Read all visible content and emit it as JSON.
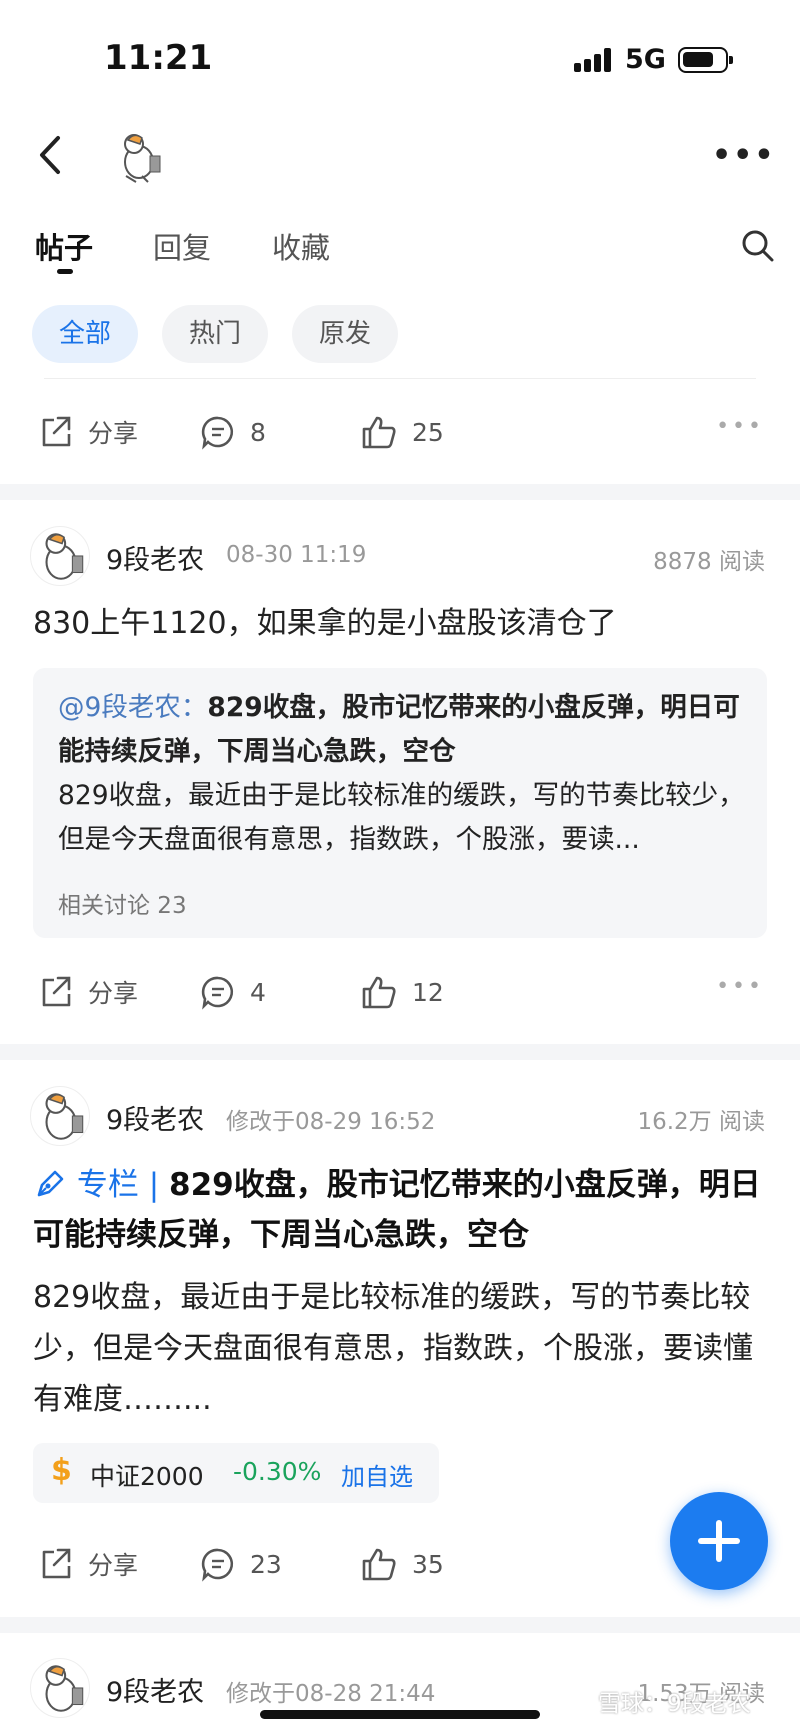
{
  "status": {
    "time": "11:21",
    "network": "5G"
  },
  "tabs": [
    {
      "label": "帖子"
    },
    {
      "label": "回复"
    },
    {
      "label": "收藏"
    }
  ],
  "chips": [
    {
      "label": "全部"
    },
    {
      "label": "热门"
    },
    {
      "label": "原发"
    }
  ],
  "action_labels": {
    "share": "分享"
  },
  "post0": {
    "comments": "8",
    "likes": "25"
  },
  "post1": {
    "author": "9段老农",
    "time": "08-30 11:19",
    "reads": "8878 阅读",
    "text": "830上午1120，如果拿的是小盘股该清仓了",
    "quote": {
      "mention": "@9段老农：",
      "title": "829收盘，股市记忆带来的小盘反弹，明日可能持续反弹，下周当心急跌，空仓",
      "body": "829收盘，最近由于是比较标准的缓跌，写的节奏比较少，但是今天盘面很有意思，指数跌，个股涨，要读...",
      "meta": "相关讨论 23"
    },
    "comments": "4",
    "likes": "12"
  },
  "post2": {
    "author": "9段老农",
    "time": "修改于08-29 16:52",
    "reads": "16.2万 阅读",
    "column_tag": "专栏 |",
    "title": "829收盘，股市记忆带来的小盘反弹，明日可能持续反弹，下周当心急跌，空仓",
    "text": "829收盘，最近由于是比较标准的缓跌，写的节奏比较少，但是今天盘面很有意思，指数跌，个股涨，要读懂有难度……...",
    "stock": {
      "symbol": "$",
      "name": "中证2000",
      "change": "-0.30%",
      "add": "加自选"
    },
    "comments": "23",
    "likes": "35"
  },
  "post3": {
    "author": "9段老农",
    "time": "修改于08-28 21:44",
    "reads": "1.53万 阅读"
  },
  "watermark": "雪球：9段老农",
  "colors": {
    "accent": "#1a73e8",
    "positive_change": "#1aa35c",
    "fab": "#1c7cf0",
    "stock_symbol": "#f3a01b"
  }
}
